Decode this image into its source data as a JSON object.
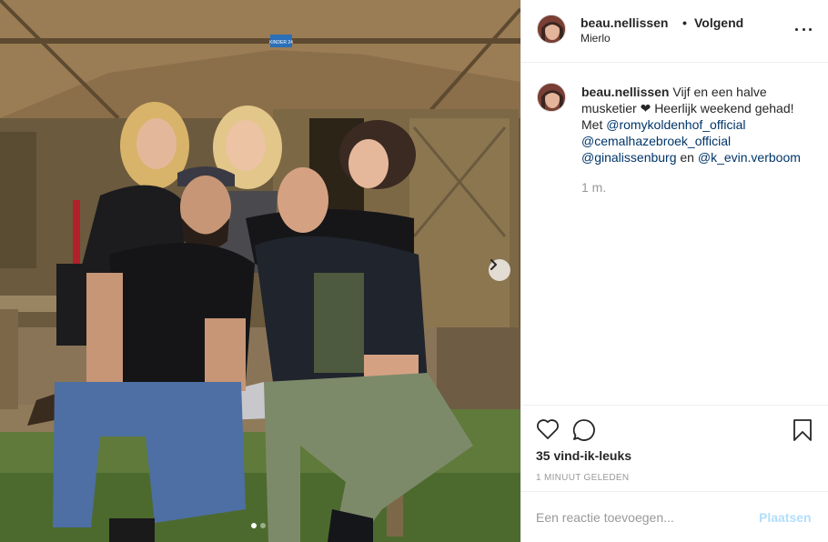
{
  "post": {
    "username": "beau.nellissen",
    "separator": "•",
    "follow_state": "Volgend",
    "location": "Mierlo"
  },
  "caption": {
    "username": "beau.nellissen",
    "text_part1": "Vijf en een halve musketier ❤ Heerlijk weekend gehad! Met",
    "mention1": "@romykoldenhof_official",
    "mention2": "@cemalhazebroek_official",
    "mention3": "@ginalissenburg",
    "connector": "en",
    "mention4": "@k_evin.verboom",
    "time": "1 m."
  },
  "photo": {
    "sign_text": "KINDER 24",
    "carousel_total": 2,
    "carousel_active": 1
  },
  "actions": {
    "like_icon": "heart-icon",
    "comment_icon": "comment-icon",
    "save_icon": "bookmark-icon",
    "likes": "35 vind-ik-leuks",
    "age": "1 MINUUT GELEDEN"
  },
  "comment_box": {
    "placeholder": "Een reactie toevoegen...",
    "submit_label": "Plaatsen"
  },
  "colors": {
    "mention": "#003569",
    "muted": "#999999",
    "submit_disabled": "#b2dffc",
    "border": "#efefef"
  }
}
